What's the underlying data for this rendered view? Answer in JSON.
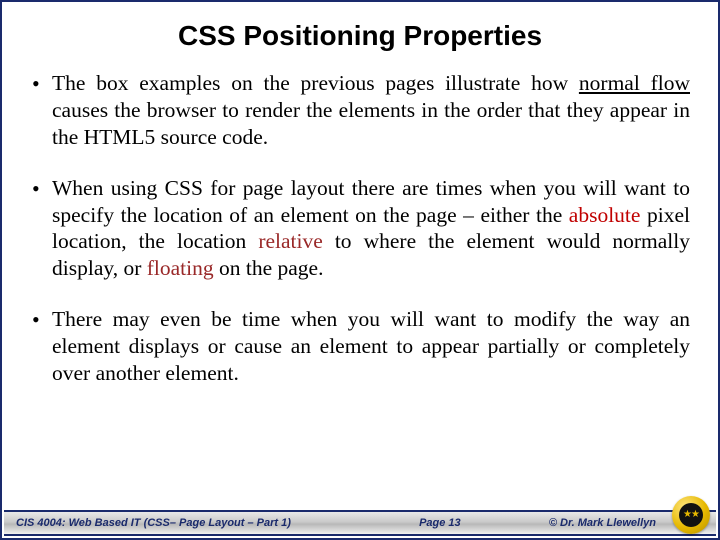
{
  "title": "CSS Positioning Properties",
  "bullets": {
    "b1_a": "The box examples on the previous pages illustrate how ",
    "b1_b": "normal flow",
    "b1_c": " causes the browser to render the elements in the order that they appear in the HTML5 source code.",
    "b2_a": "When using CSS for page layout there are times when you will want to specify the location of an element on the page – either the ",
    "b2_b": "absolute",
    "b2_c": " pixel location, the location ",
    "b2_d": "relative",
    "b2_e": " to where the element would normally display, or ",
    "b2_f": "floating",
    "b2_g": " on the page.",
    "b3": "There may even be time when you will want to modify the way an element displays or cause an element to appear partially or completely over another element."
  },
  "footer": {
    "course": "CIS 4004: Web Based IT (CSS– Page Layout – Part 1)",
    "page": "Page 13",
    "copyright": "© Dr. Mark Llewellyn"
  }
}
